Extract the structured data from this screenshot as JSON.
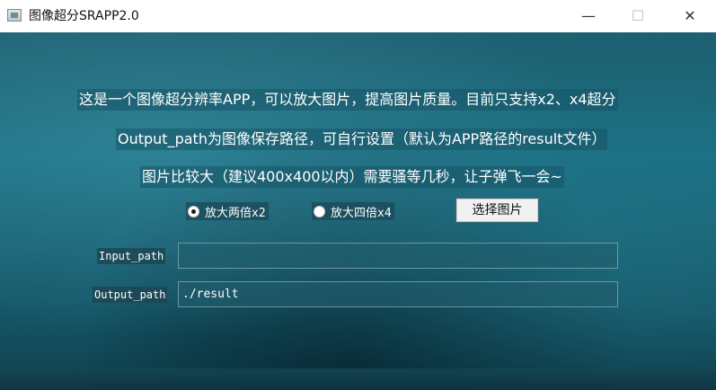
{
  "window": {
    "title": "图像超分SRAPP2.0",
    "minimize": "—",
    "maximize": "☐",
    "close": "✕",
    "icon": "app-window-icon"
  },
  "info": {
    "line1": "这是一个图像超分辨率APP，可以放大图片，提高图片质量。目前只支持x2、x4超分",
    "line2": "Output_path为图像保存路径，可自行设置（默认为APP路径的result文件）",
    "line3": "图片比较大（建议400x400以内）需要骚等几秒，让子弹飞一会~"
  },
  "scale_options": [
    {
      "label": "放大两倍x2",
      "selected": true
    },
    {
      "label": "放大四倍x4",
      "selected": false
    }
  ],
  "select_button": "选择图片",
  "input_path": {
    "label": "Input_path",
    "value": ""
  },
  "output_path": {
    "label": "Output_path",
    "value": "./result"
  },
  "colors": {
    "background": "#1b6f82",
    "text": "#ffffff",
    "titlebar": "#ffffff"
  }
}
